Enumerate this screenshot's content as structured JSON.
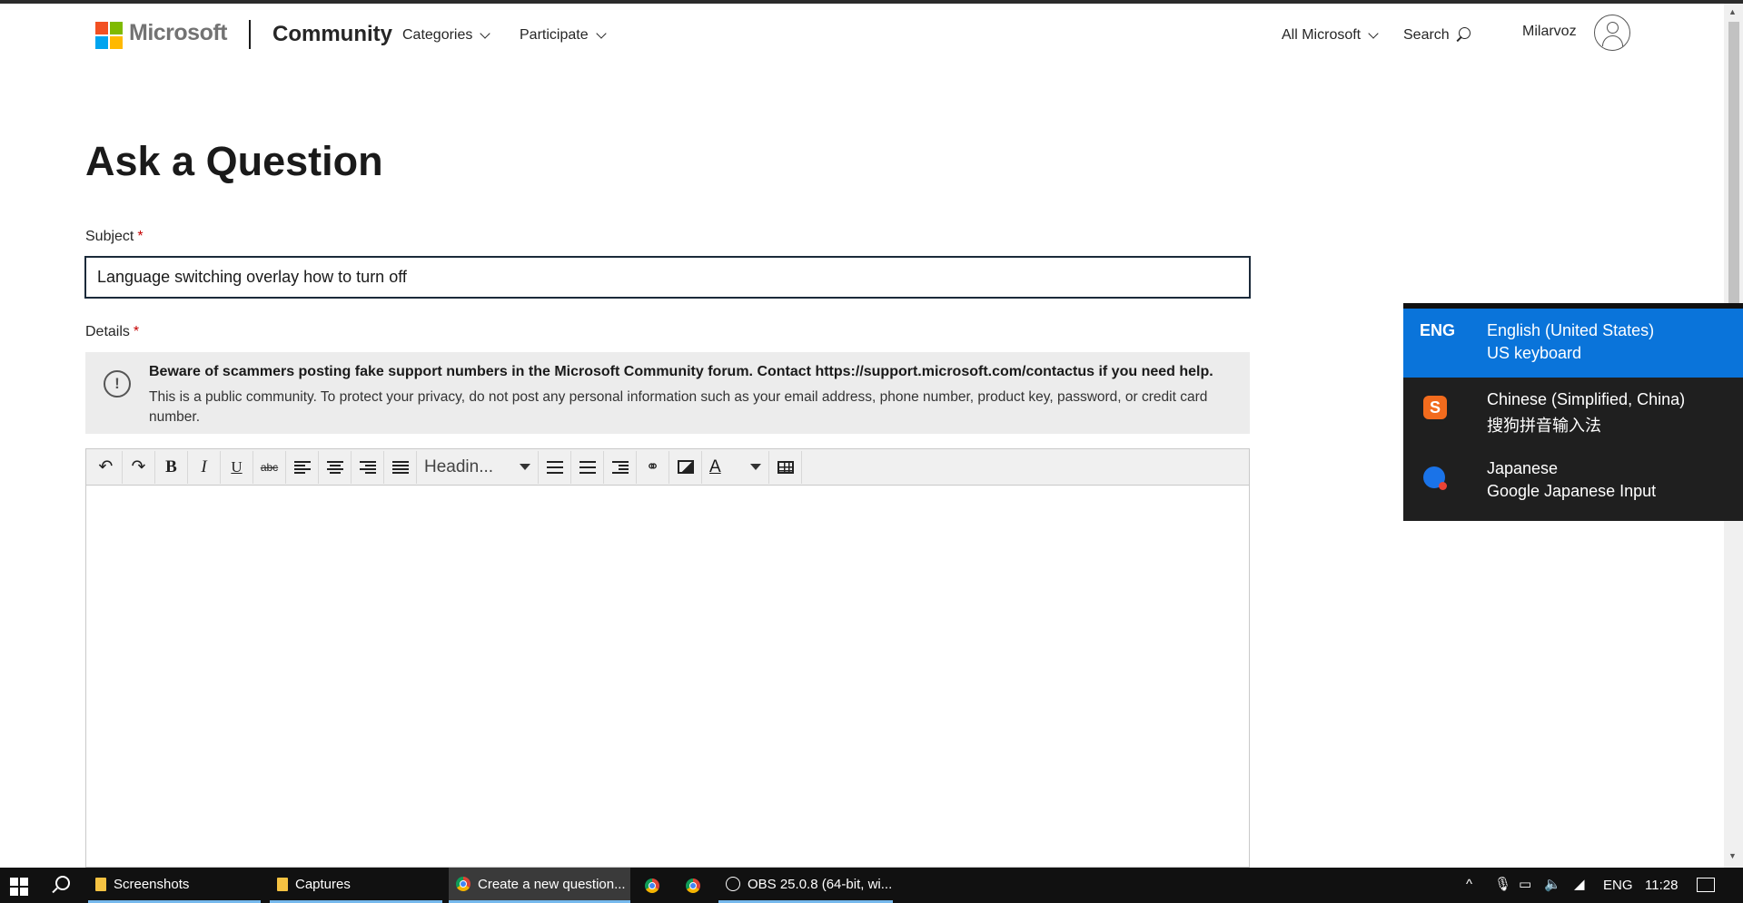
{
  "header": {
    "brand": "Microsoft",
    "site": "Community",
    "nav": [
      {
        "label": "Categories"
      },
      {
        "label": "Participate"
      }
    ],
    "all_microsoft": "All Microsoft",
    "search_label": "Search",
    "username": "Milarvoz"
  },
  "main": {
    "title": "Ask a Question",
    "subject_label": "Subject",
    "required_mark": "*",
    "subject_value": "Language switching overlay how to turn off",
    "details_label": "Details",
    "notice": {
      "icon_glyph": "!",
      "bold": "Beware of scammers posting fake support numbers in the Microsoft Community forum. Contact https://support.microsoft.com/contactus if you need help.",
      "body": "This is a public community. To protect your privacy, do not post any personal information such as your email address, phone number, product key, password, or credit card number."
    },
    "editor": {
      "toolbar": {
        "undo": "↶",
        "redo": "↷",
        "bold": "B",
        "italic": "I",
        "underline": "U",
        "strikethrough": "abc",
        "heading_value": "Headin...",
        "link": "⚭",
        "font_color": "A"
      }
    }
  },
  "language_flyout": {
    "items": [
      {
        "code": "ENG",
        "name": "English (United States)",
        "keyboard": "US keyboard",
        "active": true
      },
      {
        "icon": "sogou-icon",
        "icon_glyph": "S",
        "name": "Chinese (Simplified, China)",
        "keyboard": "搜狗拼音输入法",
        "active": false
      },
      {
        "icon": "google-japanese-input-icon",
        "name": "Japanese",
        "keyboard": "Google Japanese Input",
        "active": false
      }
    ],
    "accent_color": "#0a74da"
  },
  "taskbar": {
    "apps": [
      {
        "label": "Screenshots",
        "icon": "folder-icon"
      },
      {
        "label": "Captures",
        "icon": "folder-icon"
      },
      {
        "label": "Create a new question...",
        "icon": "chrome-icon",
        "active": true
      },
      {
        "label": "OBS 25.0.8 (64-bit, wi...",
        "icon": "obs-icon"
      }
    ],
    "tray": {
      "language": "ENG",
      "time": "11:28"
    }
  }
}
